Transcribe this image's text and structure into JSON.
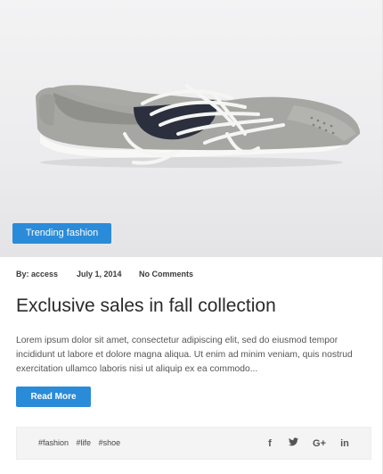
{
  "post": {
    "badge": "Trending fashion",
    "meta": {
      "author": "By: access",
      "date": "July 1, 2014",
      "comments": "No Comments"
    },
    "title": "Exclusive sales in fall collection",
    "excerpt": "Lorem ipsum dolor sit amet, consectetur adipiscing elit, sed do eiusmod tempor incididunt ut labore et dolore magna aliqua. Ut enim ad minim veniam, quis nostrud exercitation ullamco laboris nisi ut aliquip ex ea commodo...",
    "read_more": "Read More"
  },
  "footer": {
    "tags": [
      "#fashion",
      "#life",
      "#shoe"
    ],
    "social": [
      {
        "icon": "facebook-icon",
        "glyph": "f"
      },
      {
        "icon": "twitter-icon",
        "glyph": "🐦"
      },
      {
        "icon": "google-plus-icon",
        "glyph": "G+"
      },
      {
        "icon": "linkedin-icon",
        "glyph": "in"
      }
    ]
  },
  "colors": {
    "accent": "#2a8bd9",
    "text": "#2a2a2a"
  }
}
